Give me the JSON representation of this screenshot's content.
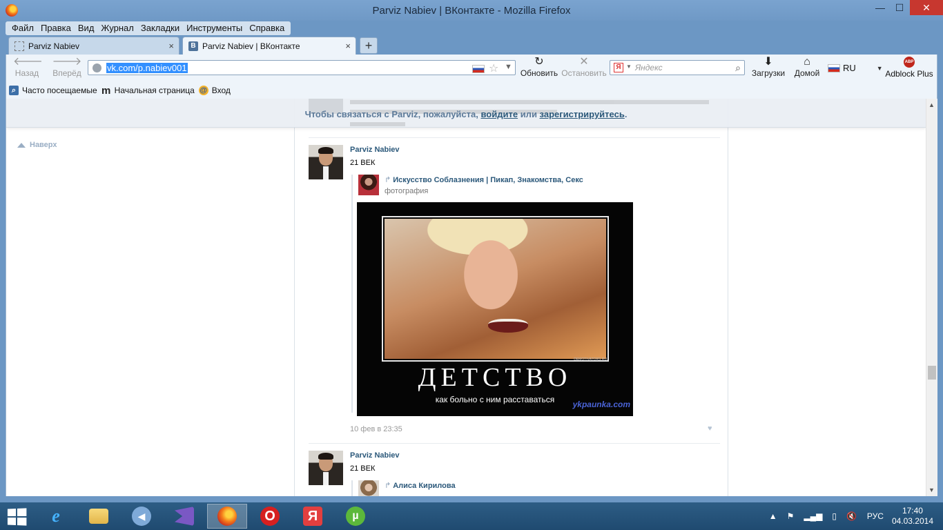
{
  "window": {
    "title": "Parviz Nabiev | ВКонтакте - Mozilla Firefox",
    "minimize": "—",
    "maximize": "☐",
    "close": "✕"
  },
  "menu": [
    "Файл",
    "Правка",
    "Вид",
    "Журнал",
    "Закладки",
    "Инструменты",
    "Справка"
  ],
  "tabs": [
    {
      "label": "Parviz Nabiev",
      "close": "×"
    },
    {
      "label": "Parviz Nabiev | ВКонтакте",
      "favicon": "В",
      "close": "×"
    }
  ],
  "newtab": "+",
  "nav": {
    "back": "Назад",
    "forward": "Вперёд",
    "reload": "Обновить",
    "stop": "Остановить",
    "downloads": "Загрузки",
    "home": "Домой",
    "lang": "RU",
    "adblock": "Adblock Plus",
    "adblock_badge": "ABP"
  },
  "url": "vk.com/p.nabiev001",
  "search": {
    "placeholder": "Яндекс",
    "engine": "Я"
  },
  "bookmarks": [
    "Часто посещаемые",
    "Начальная страница",
    "Вход"
  ],
  "notice": {
    "prefix": "Чтобы связаться с Parviz, пожалуйста, ",
    "login": "войдите",
    "or": " или ",
    "register": "зарегистрируйтесь",
    "suffix": "."
  },
  "sidebar": {
    "to_top": "Наверх"
  },
  "posts": [
    {
      "author": "Parviz Nabiev",
      "text": "21 ВЕК",
      "repost_source": "Искусство Соблазнения | Пикап, Знакомства, Секс",
      "repost_kind": "фотография",
      "image_title": "ДЕТСТВО",
      "image_caption": "как больно с ним расставаться",
      "image_site": "ykpaunka.com",
      "image_watermark": "DEMOTIVATORS.RU",
      "date": "10 фев в 23:35"
    },
    {
      "author": "Parviz Nabiev",
      "text": "21 ВЕК",
      "repost_source": "Алиса Кирилова"
    }
  ],
  "icons": {
    "back": "arrow-left-icon",
    "forward": "arrow-right-icon",
    "reload": "reload-icon",
    "stop": "stop-icon",
    "downloads": "download-icon",
    "home": "home-icon",
    "like": "heart-icon"
  },
  "taskbar": {
    "apps": [
      "internet-explorer",
      "file-explorer",
      "audio",
      "visual-studio",
      "firefox",
      "opera",
      "yandex",
      "utorrent"
    ],
    "tray_lang": "РУС",
    "time": "17:40",
    "date": "04.03.2014"
  }
}
